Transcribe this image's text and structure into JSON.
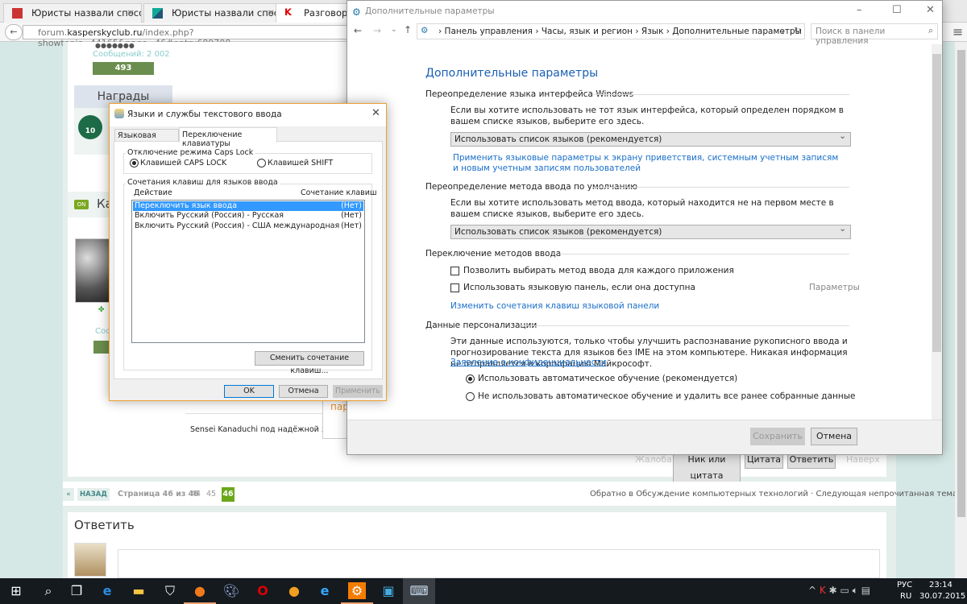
{
  "browser": {
    "tabs": [
      {
        "title": "Юристы назвали способ..."
      },
      {
        "title": "Юристы назвали способ..."
      },
      {
        "title": "Разговоры за ж"
      }
    ],
    "url_prefix": "forum.",
    "url_domain": "kasperskyclub.ru",
    "url_path": "/index.php?showtopic=44165&page=46#entry689708"
  },
  "forum": {
    "stars": "●●●●●●●",
    "posts1": "Сообщений: 2 002",
    "rep1": "493",
    "awards_title": "Награды",
    "award_num": "10",
    "online_badge": "ON",
    "username2_partial": "Ка",
    "posts2_partial": "Соо",
    "signature": "Sensei Kanaduchi под надёжной защитой Л",
    "orange_partial": "пар",
    "post_actions": {
      "report": "Жалоба",
      "nick_quote": "Ник или цитата",
      "quote": "Цитата",
      "reply": "Ответить",
      "top": "Наверх"
    },
    "pager": {
      "first": "«",
      "back": "НАЗАД",
      "page_info": "Страница 46 из 46",
      "pages": [
        "44",
        "45"
      ],
      "current": "46"
    },
    "back_link": "Обратно в Обсуждение компьютерных технологий",
    "sep": "·",
    "next_unread": "Следующая непрочитанная тема →",
    "reply_title": "Ответить"
  },
  "control_panel": {
    "title": "Дополнительные параметры",
    "breadcrumb": [
      "Панель управления",
      "Часы, язык и регион",
      "Язык",
      "Дополнительные параметры"
    ],
    "search_placeholder": "Поиск в панели управления",
    "heading": "Дополнительные параметры",
    "s1_title": "Переопределение языка интерфейса Windows",
    "s1_desc": "Если вы хотите использовать не тот язык интерфейса, который определен порядком в вашем списке языков, выберите его здесь.",
    "s1_select": "Использовать список языков (рекомендуется)",
    "s1_link": "Применить языковые параметры к экрану приветствия, системным учетным записям и новым учетным записям пользователей",
    "s2_title": "Переопределение метода ввода по умолчанию",
    "s2_desc": "Если вы хотите использовать метод ввода, который находится не на первом месте в вашем списке языков, выберите его здесь.",
    "s2_select": "Использовать список языков (рекомендуется)",
    "s3_title": "Переключение методов ввода",
    "s3_cb1": "Позволить выбирать метод ввода для каждого приложения",
    "s3_cb2": "Использовать языковую панель, если она доступна",
    "s3_params": "Параметры",
    "s3_link": "Изменить сочетания клавиш языковой панели",
    "s4_title": "Данные персонализации",
    "s4_desc": "Эти данные используются, только чтобы улучшить распознавание рукописного ввода и прогнозирование текста для языков без IME на этом компьютере. Никакая информация не отправляется в корпорацию Майкрософт.",
    "s4_link": "Заявление о конфиденциальности",
    "s4_r1": "Использовать автоматическое обучение (рекомендуется)",
    "s4_r2": "Не использовать автоматическое обучение и удалить все ранее собранные данные",
    "save": "Сохранить",
    "cancel": "Отмена"
  },
  "dialog": {
    "title": "Языки и службы текстового ввода",
    "tabs": [
      "Языковая панель",
      "Переключение клавиатуры"
    ],
    "caps_group": "Отключение режима Caps Lock",
    "caps_opt1": "Клавишей CAPS LOCK",
    "caps_opt2": "Клавишей SHIFT",
    "hotkeys_group": "Сочетания клавиш для языков ввода",
    "col_action": "Действие",
    "col_keys": "Сочетание клавиш",
    "rows": [
      {
        "action": "Переключить язык ввода",
        "keys": "(Нет)"
      },
      {
        "action": "Включить Русский (Россия) - Русская",
        "keys": "(Нет)"
      },
      {
        "action": "Включить Русский (Россия) - США международная",
        "keys": "(Нет)"
      }
    ],
    "change_btn": "Сменить сочетание клавиш...",
    "ok": "OK",
    "cancel": "Отмена",
    "apply": "Применить"
  },
  "taskbar": {
    "lang1": "РУС",
    "lang2": "RU",
    "time": "23:14",
    "date": "30.07.2015"
  }
}
